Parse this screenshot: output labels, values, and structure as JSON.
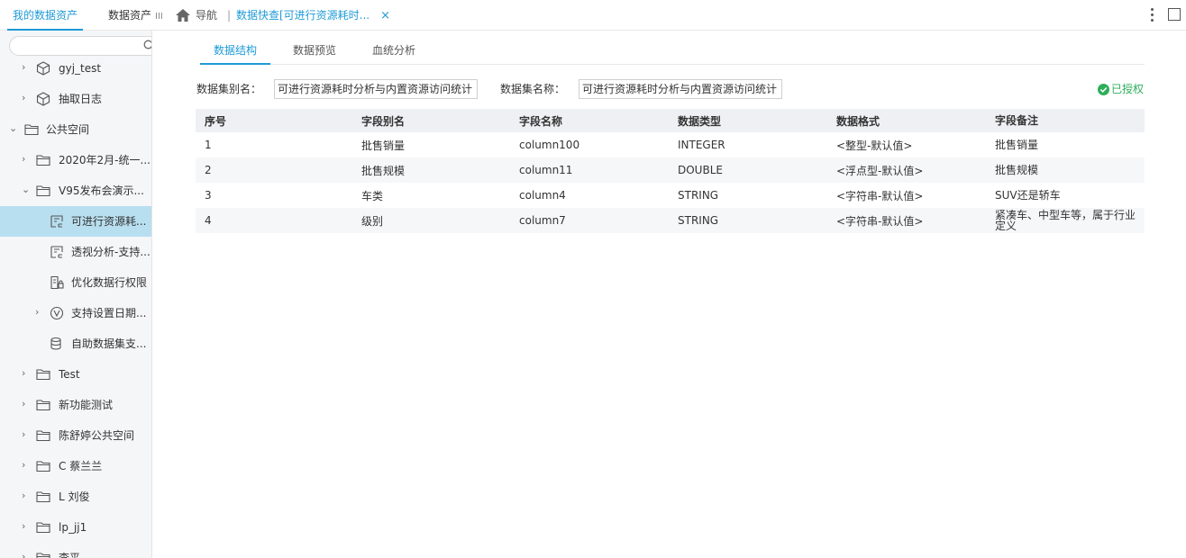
{
  "top_tabs": {
    "my_data": "我的数据资产",
    "data_assets": "数据资产",
    "data_assets_menu_icon": "III",
    "nav": "导航",
    "separator": "|",
    "quick_view": "数据快查[可进行资源耗时...",
    "close": "×"
  },
  "sidebar": {
    "search_placeholder": "",
    "items": [
      {
        "label": "gyj_test",
        "icon": "cube-icon",
        "expanded": false
      },
      {
        "label": "抽取日志",
        "icon": "cube-icon",
        "expanded": false
      },
      {
        "label": "公共空间",
        "icon": "folder-icon",
        "expanded": true
      },
      {
        "label": "2020年2月-统一...",
        "icon": "folder-icon",
        "expanded": false
      },
      {
        "label": "V95发布会演示...",
        "icon": "folder-icon",
        "expanded": true
      },
      {
        "label": "可进行资源耗...",
        "icon": "dataset-icon",
        "selected": true
      },
      {
        "label": "透视分析-支持...",
        "icon": "dataset-icon"
      },
      {
        "label": "优化数据行权限",
        "icon": "doc-lock-icon"
      },
      {
        "label": "支持设置日期...",
        "icon": "v-circle-icon",
        "expanded": false
      },
      {
        "label": "自助数据集支...",
        "icon": "db-icon"
      },
      {
        "label": "Test",
        "icon": "folder-icon",
        "expanded": false
      },
      {
        "label": "新功能测试",
        "icon": "folder-icon",
        "expanded": false
      },
      {
        "label": "陈舒婷公共空间",
        "icon": "folder-icon",
        "expanded": false
      },
      {
        "label": "C 蔡兰兰",
        "icon": "folder-icon",
        "expanded": false
      },
      {
        "label": "L 刘俊",
        "icon": "folder-icon",
        "expanded": false
      },
      {
        "label": "lp_jj1",
        "icon": "folder-icon",
        "expanded": false
      },
      {
        "label": "李平",
        "icon": "folder-icon",
        "expanded": false
      }
    ]
  },
  "main": {
    "tabs": [
      "数据结构",
      "数据预览",
      "血统分析"
    ],
    "active_tab": 0,
    "alias_label": "数据集别名：",
    "alias_value": "可进行资源耗时分析与内置资源访问统计",
    "name_label": "数据集名称：",
    "name_value": "可进行资源耗时分析与内置资源访问统计",
    "auth_status": "已授权",
    "accent_color": "#1e9ad6",
    "auth_color": "#2eae5a"
  },
  "table": {
    "headers": [
      "序号",
      "字段别名",
      "字段名称",
      "数据类型",
      "数据格式",
      "字段备注"
    ],
    "rows": [
      [
        "1",
        "批售销量",
        "column100",
        "INTEGER",
        "<整型-默认值>",
        "批售销量"
      ],
      [
        "2",
        "批售规模",
        "column11",
        "DOUBLE",
        "<浮点型-默认值>",
        "批售规模"
      ],
      [
        "3",
        "车类",
        "column4",
        "STRING",
        "<字符串-默认值>",
        "SUV还是轿车"
      ],
      [
        "4",
        "级别",
        "column7",
        "STRING",
        "<字符串-默认值>",
        "紧凑车、中型车等，属于行业定义"
      ]
    ]
  }
}
